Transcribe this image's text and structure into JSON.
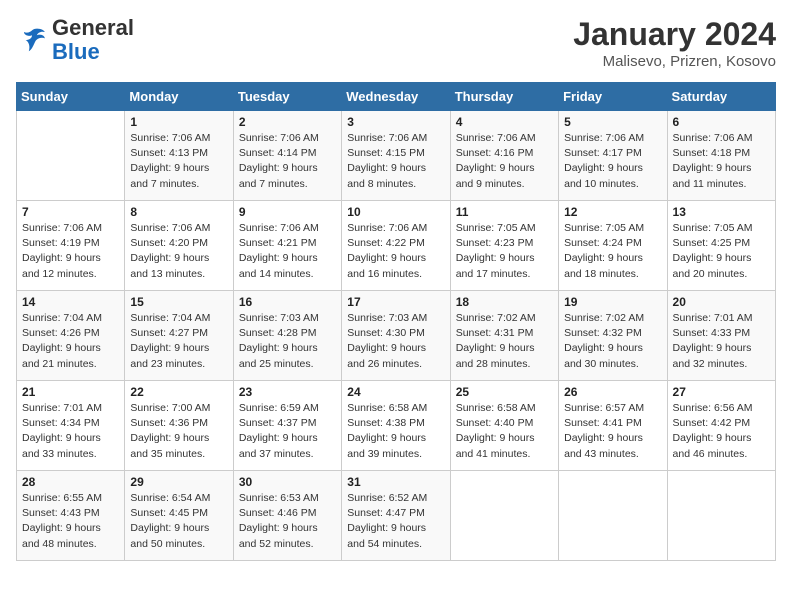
{
  "logo": {
    "text_general": "General",
    "text_blue": "Blue"
  },
  "header": {
    "title": "January 2024",
    "subtitle": "Malisevo, Prizren, Kosovo"
  },
  "days_of_week": [
    "Sunday",
    "Monday",
    "Tuesday",
    "Wednesday",
    "Thursday",
    "Friday",
    "Saturday"
  ],
  "weeks": [
    [
      {
        "day": "",
        "sunrise": "",
        "sunset": "",
        "daylight": ""
      },
      {
        "day": "1",
        "sunrise": "Sunrise: 7:06 AM",
        "sunset": "Sunset: 4:13 PM",
        "daylight": "Daylight: 9 hours and 7 minutes."
      },
      {
        "day": "2",
        "sunrise": "Sunrise: 7:06 AM",
        "sunset": "Sunset: 4:14 PM",
        "daylight": "Daylight: 9 hours and 7 minutes."
      },
      {
        "day": "3",
        "sunrise": "Sunrise: 7:06 AM",
        "sunset": "Sunset: 4:15 PM",
        "daylight": "Daylight: 9 hours and 8 minutes."
      },
      {
        "day": "4",
        "sunrise": "Sunrise: 7:06 AM",
        "sunset": "Sunset: 4:16 PM",
        "daylight": "Daylight: 9 hours and 9 minutes."
      },
      {
        "day": "5",
        "sunrise": "Sunrise: 7:06 AM",
        "sunset": "Sunset: 4:17 PM",
        "daylight": "Daylight: 9 hours and 10 minutes."
      },
      {
        "day": "6",
        "sunrise": "Sunrise: 7:06 AM",
        "sunset": "Sunset: 4:18 PM",
        "daylight": "Daylight: 9 hours and 11 minutes."
      }
    ],
    [
      {
        "day": "7",
        "sunrise": "Sunrise: 7:06 AM",
        "sunset": "Sunset: 4:19 PM",
        "daylight": "Daylight: 9 hours and 12 minutes."
      },
      {
        "day": "8",
        "sunrise": "Sunrise: 7:06 AM",
        "sunset": "Sunset: 4:20 PM",
        "daylight": "Daylight: 9 hours and 13 minutes."
      },
      {
        "day": "9",
        "sunrise": "Sunrise: 7:06 AM",
        "sunset": "Sunset: 4:21 PM",
        "daylight": "Daylight: 9 hours and 14 minutes."
      },
      {
        "day": "10",
        "sunrise": "Sunrise: 7:06 AM",
        "sunset": "Sunset: 4:22 PM",
        "daylight": "Daylight: 9 hours and 16 minutes."
      },
      {
        "day": "11",
        "sunrise": "Sunrise: 7:05 AM",
        "sunset": "Sunset: 4:23 PM",
        "daylight": "Daylight: 9 hours and 17 minutes."
      },
      {
        "day": "12",
        "sunrise": "Sunrise: 7:05 AM",
        "sunset": "Sunset: 4:24 PM",
        "daylight": "Daylight: 9 hours and 18 minutes."
      },
      {
        "day": "13",
        "sunrise": "Sunrise: 7:05 AM",
        "sunset": "Sunset: 4:25 PM",
        "daylight": "Daylight: 9 hours and 20 minutes."
      }
    ],
    [
      {
        "day": "14",
        "sunrise": "Sunrise: 7:04 AM",
        "sunset": "Sunset: 4:26 PM",
        "daylight": "Daylight: 9 hours and 21 minutes."
      },
      {
        "day": "15",
        "sunrise": "Sunrise: 7:04 AM",
        "sunset": "Sunset: 4:27 PM",
        "daylight": "Daylight: 9 hours and 23 minutes."
      },
      {
        "day": "16",
        "sunrise": "Sunrise: 7:03 AM",
        "sunset": "Sunset: 4:28 PM",
        "daylight": "Daylight: 9 hours and 25 minutes."
      },
      {
        "day": "17",
        "sunrise": "Sunrise: 7:03 AM",
        "sunset": "Sunset: 4:30 PM",
        "daylight": "Daylight: 9 hours and 26 minutes."
      },
      {
        "day": "18",
        "sunrise": "Sunrise: 7:02 AM",
        "sunset": "Sunset: 4:31 PM",
        "daylight": "Daylight: 9 hours and 28 minutes."
      },
      {
        "day": "19",
        "sunrise": "Sunrise: 7:02 AM",
        "sunset": "Sunset: 4:32 PM",
        "daylight": "Daylight: 9 hours and 30 minutes."
      },
      {
        "day": "20",
        "sunrise": "Sunrise: 7:01 AM",
        "sunset": "Sunset: 4:33 PM",
        "daylight": "Daylight: 9 hours and 32 minutes."
      }
    ],
    [
      {
        "day": "21",
        "sunrise": "Sunrise: 7:01 AM",
        "sunset": "Sunset: 4:34 PM",
        "daylight": "Daylight: 9 hours and 33 minutes."
      },
      {
        "day": "22",
        "sunrise": "Sunrise: 7:00 AM",
        "sunset": "Sunset: 4:36 PM",
        "daylight": "Daylight: 9 hours and 35 minutes."
      },
      {
        "day": "23",
        "sunrise": "Sunrise: 6:59 AM",
        "sunset": "Sunset: 4:37 PM",
        "daylight": "Daylight: 9 hours and 37 minutes."
      },
      {
        "day": "24",
        "sunrise": "Sunrise: 6:58 AM",
        "sunset": "Sunset: 4:38 PM",
        "daylight": "Daylight: 9 hours and 39 minutes."
      },
      {
        "day": "25",
        "sunrise": "Sunrise: 6:58 AM",
        "sunset": "Sunset: 4:40 PM",
        "daylight": "Daylight: 9 hours and 41 minutes."
      },
      {
        "day": "26",
        "sunrise": "Sunrise: 6:57 AM",
        "sunset": "Sunset: 4:41 PM",
        "daylight": "Daylight: 9 hours and 43 minutes."
      },
      {
        "day": "27",
        "sunrise": "Sunrise: 6:56 AM",
        "sunset": "Sunset: 4:42 PM",
        "daylight": "Daylight: 9 hours and 46 minutes."
      }
    ],
    [
      {
        "day": "28",
        "sunrise": "Sunrise: 6:55 AM",
        "sunset": "Sunset: 4:43 PM",
        "daylight": "Daylight: 9 hours and 48 minutes."
      },
      {
        "day": "29",
        "sunrise": "Sunrise: 6:54 AM",
        "sunset": "Sunset: 4:45 PM",
        "daylight": "Daylight: 9 hours and 50 minutes."
      },
      {
        "day": "30",
        "sunrise": "Sunrise: 6:53 AM",
        "sunset": "Sunset: 4:46 PM",
        "daylight": "Daylight: 9 hours and 52 minutes."
      },
      {
        "day": "31",
        "sunrise": "Sunrise: 6:52 AM",
        "sunset": "Sunset: 4:47 PM",
        "daylight": "Daylight: 9 hours and 54 minutes."
      },
      {
        "day": "",
        "sunrise": "",
        "sunset": "",
        "daylight": ""
      },
      {
        "day": "",
        "sunrise": "",
        "sunset": "",
        "daylight": ""
      },
      {
        "day": "",
        "sunrise": "",
        "sunset": "",
        "daylight": ""
      }
    ]
  ]
}
